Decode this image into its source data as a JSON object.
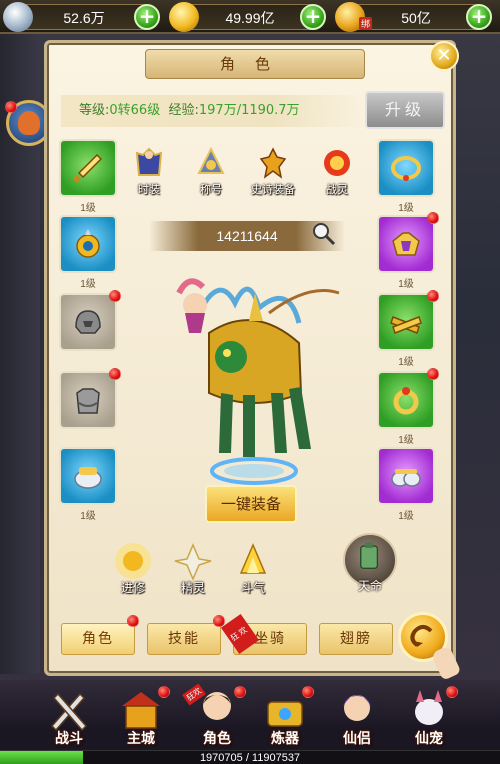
{
  "currencies": [
    {
      "name": "silver",
      "value": "52.6万"
    },
    {
      "name": "gold",
      "value": "49.99亿"
    },
    {
      "name": "bound-gold",
      "value": "50亿",
      "tag": "绑"
    }
  ],
  "panel": {
    "title": "角色",
    "level_label": "等级:",
    "level_value": "0转66级",
    "exp_label": "经验:",
    "exp_value": "197万/1190.7万",
    "upgrade_label": "升级",
    "power": "14211644",
    "equip_all_label": "一键装备"
  },
  "cosmetics": [
    {
      "label": "时装",
      "icon": "costume-icon"
    },
    {
      "label": "称号",
      "icon": "title-icon"
    },
    {
      "label": "史诗装备",
      "icon": "epic-gear-icon"
    },
    {
      "label": "战灵",
      "icon": "war-spirit-icon"
    }
  ],
  "left_slots": [
    {
      "icon": "sword-icon",
      "quality": "green",
      "level": "1级"
    },
    {
      "icon": "amulet-icon",
      "quality": "blue",
      "level": "1级"
    },
    {
      "icon": "helmet-icon",
      "quality": "empty",
      "level": ""
    },
    {
      "icon": "armor-icon",
      "quality": "empty",
      "level": ""
    },
    {
      "icon": "boots-icon",
      "quality": "blue",
      "level": "1级"
    }
  ],
  "right_slots": [
    {
      "icon": "necklace-icon",
      "quality": "blue",
      "level": "1级"
    },
    {
      "icon": "shoulder-icon",
      "quality": "purple",
      "level": "1级"
    },
    {
      "icon": "belt-icon",
      "quality": "green",
      "level": "1级"
    },
    {
      "icon": "ring-icon",
      "quality": "green",
      "level": "1级"
    },
    {
      "icon": "shoes-icon",
      "quality": "purple",
      "level": "1级"
    }
  ],
  "functions": [
    {
      "label": "进修",
      "icon": "cultivate-icon"
    },
    {
      "label": "精灵",
      "icon": "spirit-icon"
    },
    {
      "label": "斗气",
      "icon": "battle-aura-icon"
    }
  ],
  "tianming_label": "天命",
  "sub_tabs": [
    "角色",
    "技能",
    "坐骑",
    "翅膀"
  ],
  "sub_tab_new": "狂欢",
  "bottom_nav": [
    {
      "label": "战斗",
      "icon": "battle-icon"
    },
    {
      "label": "主城",
      "icon": "city-icon"
    },
    {
      "label": "角色",
      "icon": "character-icon"
    },
    {
      "label": "炼器",
      "icon": "forge-icon"
    },
    {
      "label": "仙侣",
      "icon": "companion-icon"
    },
    {
      "label": "仙宠",
      "icon": "pet-icon"
    }
  ],
  "bottom_nav_new": "狂欢",
  "exp_bar": {
    "text": "1970705 / 11907537",
    "fraction": 0.1655
  }
}
